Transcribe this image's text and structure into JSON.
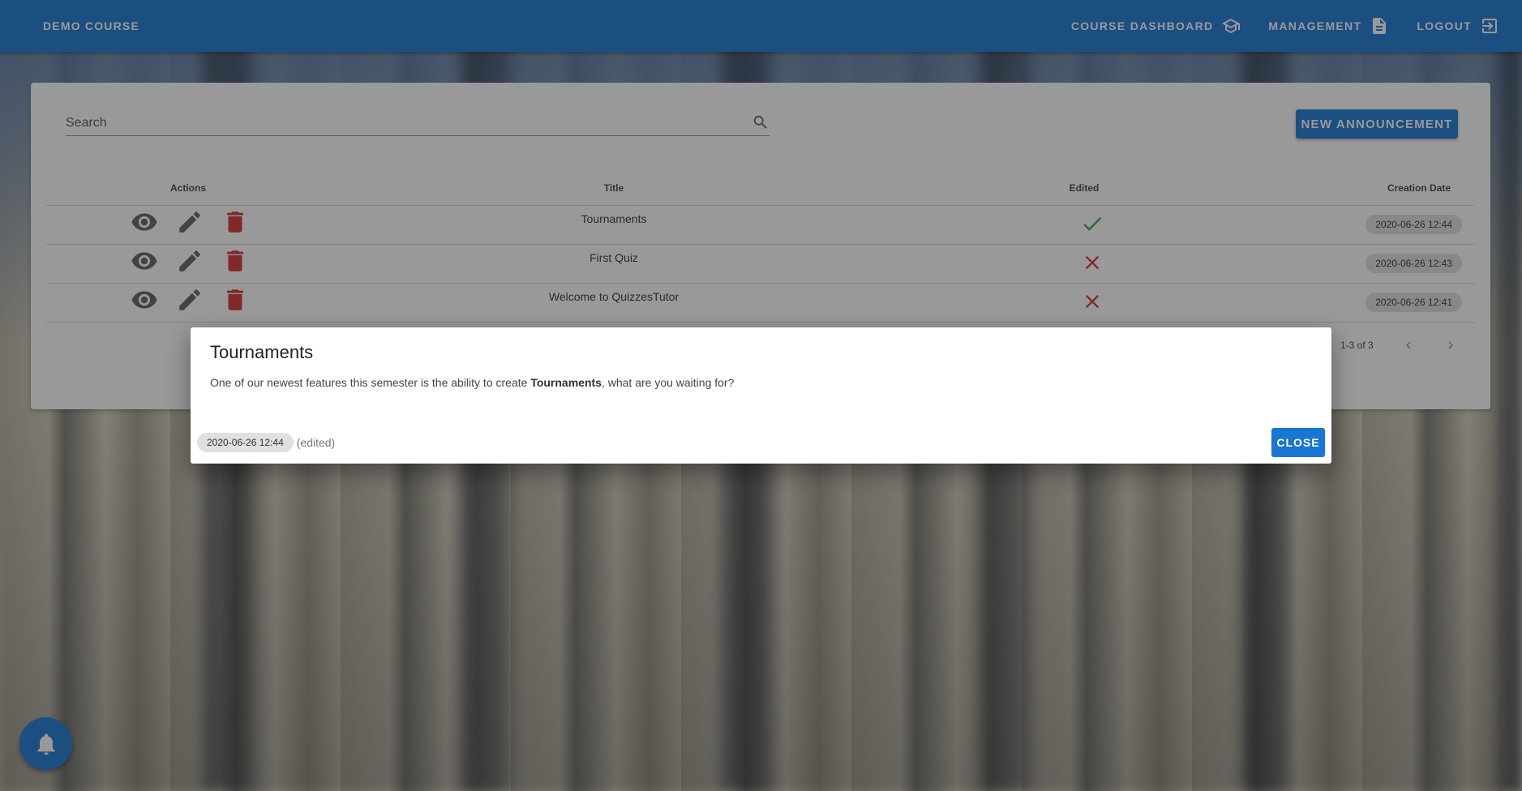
{
  "app": {
    "brand": "DEMO COURSE"
  },
  "nav": [
    {
      "label": "COURSE DASHBOARD",
      "icon": "school-icon"
    },
    {
      "label": "MANAGEMENT",
      "icon": "document-icon"
    },
    {
      "label": "LOGOUT",
      "icon": "logout-icon"
    }
  ],
  "search": {
    "placeholder": "Search"
  },
  "toolbar": {
    "new_label": "NEW ANNOUNCEMENT"
  },
  "table": {
    "headers": {
      "actions": "Actions",
      "title": "Title",
      "edited": "Edited",
      "date": "Creation Date"
    },
    "rows": [
      {
        "title": "Tournaments",
        "edited": true,
        "date": "2020-06-26 12:44"
      },
      {
        "title": "First Quiz",
        "edited": false,
        "date": "2020-06-26 12:43"
      },
      {
        "title": "Welcome to QuizzesTutor",
        "edited": false,
        "date": "2020-06-26 12:41"
      }
    ]
  },
  "pagination": {
    "range": "1-3 of 3"
  },
  "dialog": {
    "title": "Tournaments",
    "body_before": "One of our newest features this semester is the ability to create ",
    "body_bold": "Tournaments",
    "body_after": ", what are you waiting for?",
    "date": "2020-06-26 12:44",
    "edited_label": "(edited)",
    "close_label": "CLOSE"
  },
  "colors": {
    "primary": "#1976d2",
    "danger": "#d32f2f",
    "success": "#43a047",
    "icon_grey": "#616161"
  }
}
